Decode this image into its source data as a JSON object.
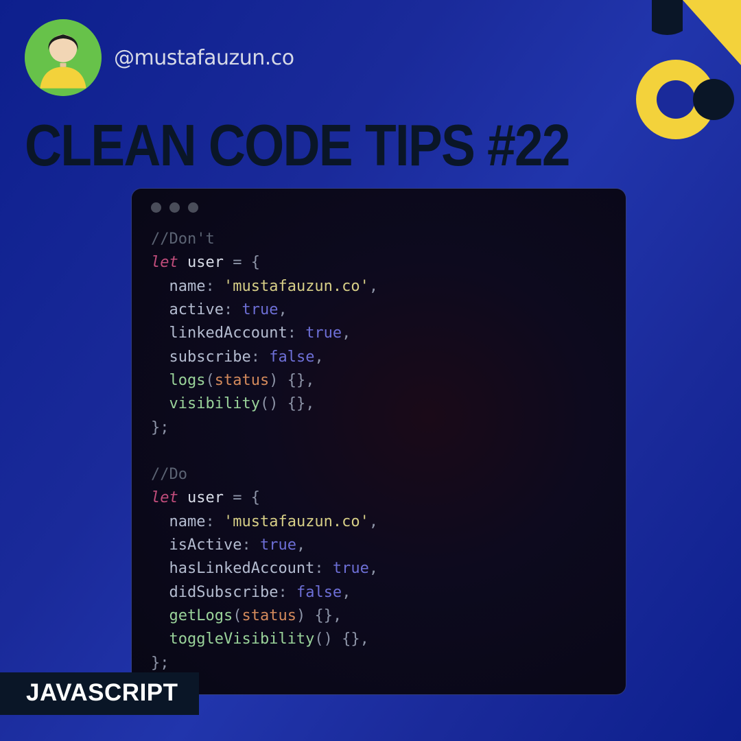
{
  "handle": "@mustafauzun.co",
  "title": "CLEAN CODE TIPS #22",
  "tag_label": "JAVASCRIPT",
  "colors": {
    "bg_blue": "#1a2a9a",
    "dark_navy": "#0a1627",
    "yellow": "#f3d23b",
    "avatar_green": "#67c24a"
  },
  "code": {
    "dont_comment": "//Don't",
    "do_comment": "//Do",
    "keyword_let": "let",
    "var_user": "user",
    "equals": " = ",
    "brace_open": "{",
    "brace_close_semi": "};",
    "string_value": "'mustafauzun.co'",
    "true": "true",
    "false": "false",
    "dont": {
      "name_key": "name",
      "active_key": "active",
      "linked_key": "linkedAccount",
      "subscribe_key": "subscribe",
      "logs_fn": "logs",
      "logs_param": "status",
      "visibility_fn": "visibility"
    },
    "do": {
      "name_key": "name",
      "isActive_key": "isActive",
      "hasLinked_key": "hasLinkedAccount",
      "didSubscribe_key": "didSubscribe",
      "getLogs_fn": "getLogs",
      "getLogs_param": "status",
      "toggleVis_fn": "toggleVisibility"
    }
  }
}
